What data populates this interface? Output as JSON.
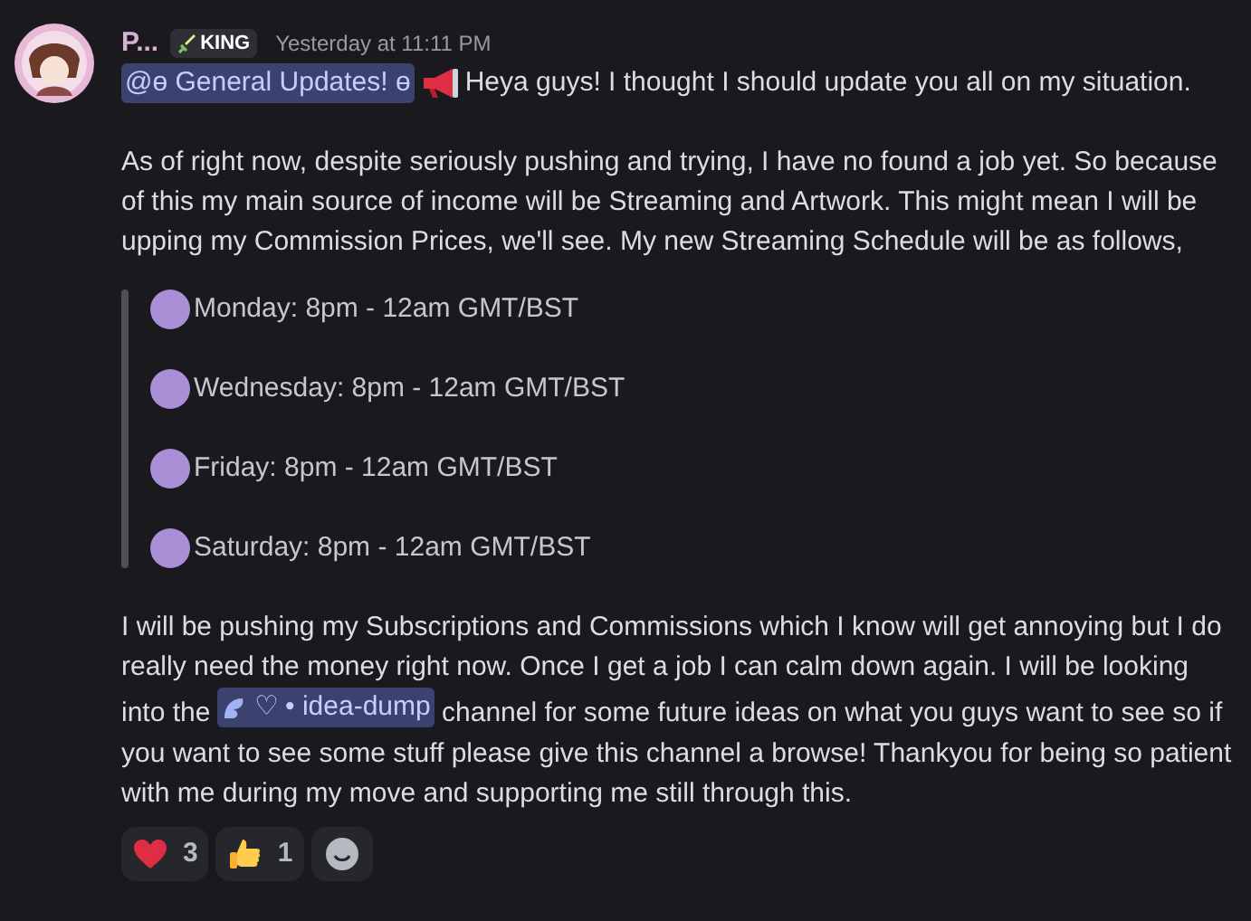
{
  "message": {
    "author": "P...",
    "role_badge": "KING",
    "timestamp": "Yesterday at 11:11 PM",
    "role_mention": "@ɵ General Updates! ɵ",
    "first_line": "Heya guys! I thought I should update you all on my situation.",
    "paragraph_1": "As of right now, despite seriously pushing and trying, I have no found a job yet. So because of this my main source of income will be Streaming and Artwork. This might mean I will be upping my Commission Prices, we'll see. My new Streaming Schedule will be as follows,",
    "schedule": [
      {
        "text": "Monday: 8pm - 12am GMT/BST"
      },
      {
        "text": "Wednesday: 8pm - 12am GMT/BST"
      },
      {
        "text": "Friday: 8pm - 12am GMT/BST"
      },
      {
        "text": "Saturday: 8pm - 12am GMT/BST"
      }
    ],
    "paragraph_2_before": "I will be pushing my Subscriptions and Commissions which I know will get annoying but I do really need the money right now. Once I get a job I can calm down again. I will be looking into the",
    "channel_mention": "♡ • idea-dump",
    "paragraph_2_after": "channel for some future ideas on what you guys want to see so if you want to see some stuff please give this channel a browse! Thankyou for being so patient with me during my move and supporting me still through this.",
    "reactions": [
      {
        "kind": "heart",
        "count": "3"
      },
      {
        "kind": "thumbs",
        "count": "1"
      }
    ]
  }
}
